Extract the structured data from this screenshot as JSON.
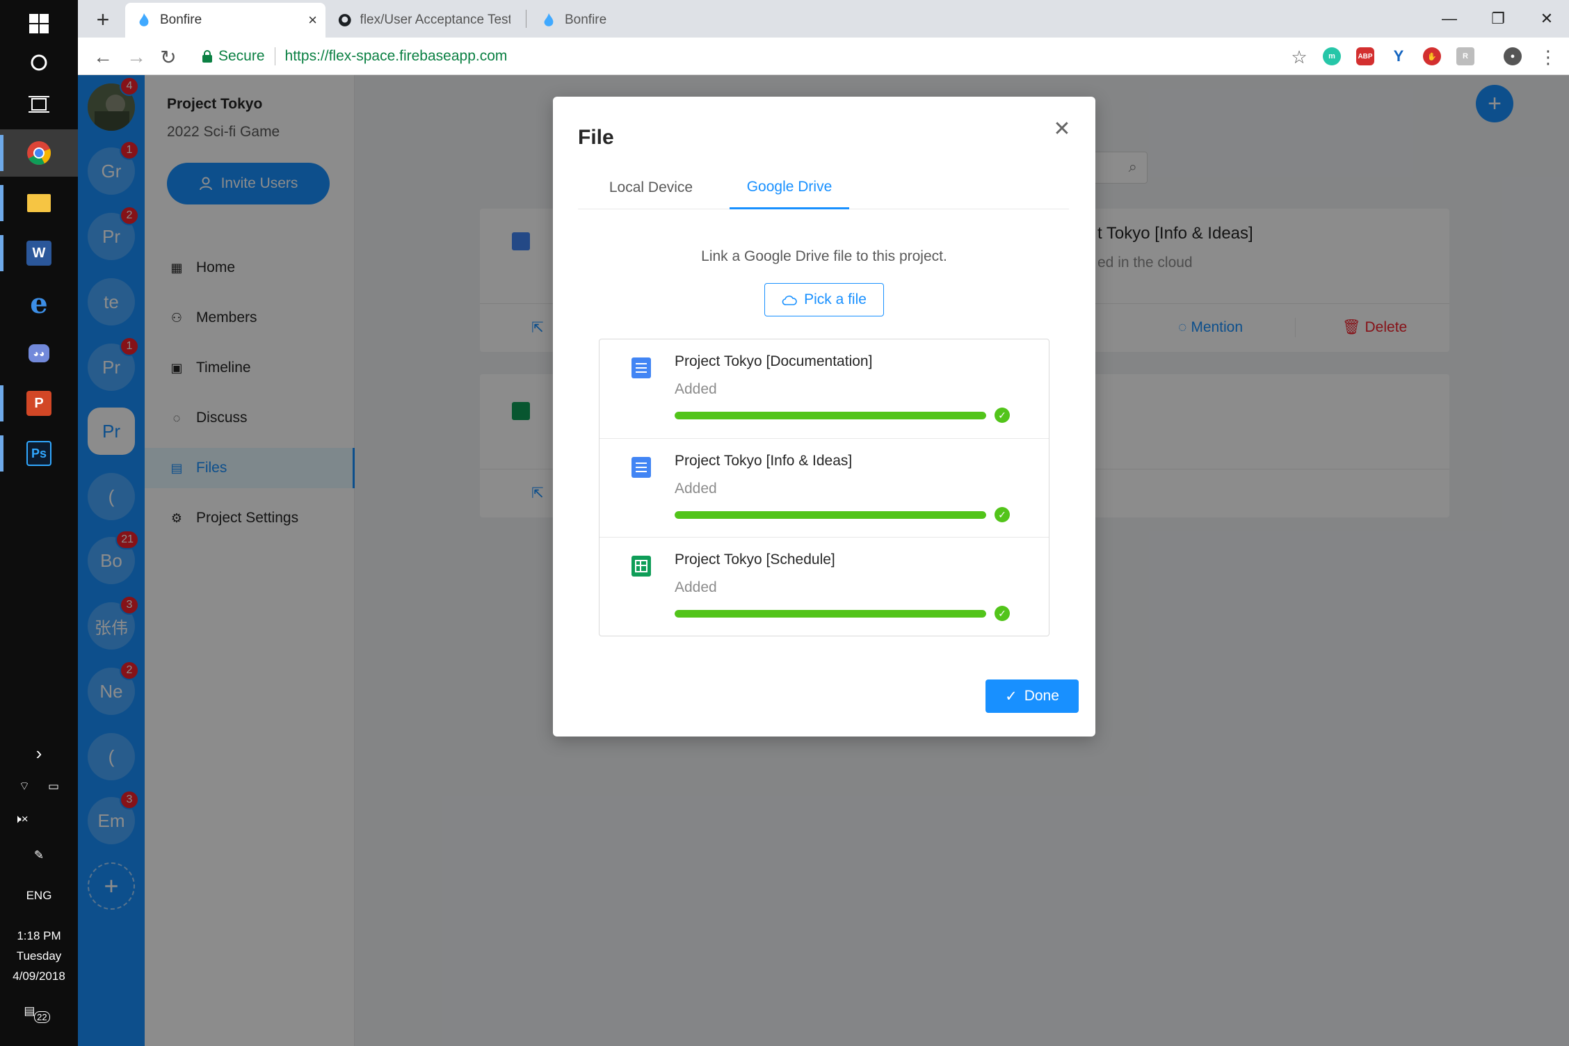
{
  "taskbar": {
    "lang": "ENG",
    "time": "1:18 PM",
    "day": "Tuesday",
    "date": "4/09/2018",
    "notifications": "22"
  },
  "browser": {
    "tabs": [
      {
        "title": "Bonfire",
        "active": true
      },
      {
        "title": "flex/User Acceptance Testing"
      },
      {
        "title": "Bonfire"
      }
    ],
    "secure_label": "Secure",
    "url": "https://flex-space.firebaseapp.com",
    "extensions": [
      {
        "icon": "m-icon",
        "label": "m",
        "color": "#26c6a8"
      },
      {
        "icon": "abp-icon",
        "label": "ABP",
        "color": "#d32f2f"
      },
      {
        "icon": "y-icon",
        "label": "Y",
        "color": "#1565c0"
      },
      {
        "icon": "stop-icon",
        "label": "",
        "color": "#d32f2f"
      },
      {
        "icon": "ext-gray-icon",
        "label": "",
        "color": "#9e9e9e"
      }
    ]
  },
  "servers": [
    {
      "label": "",
      "badge": "4",
      "avatar": true
    },
    {
      "label": "Gr",
      "badge": "1"
    },
    {
      "label": "Pr",
      "badge": "2"
    },
    {
      "label": "te",
      "badge": ""
    },
    {
      "label": "Pr",
      "badge": "1"
    },
    {
      "label": "Pr",
      "badge": "",
      "selected": true
    },
    {
      "label": "(",
      "badge": ""
    },
    {
      "label": "Bo",
      "badge": "21"
    },
    {
      "label": "张伟",
      "badge": "3"
    },
    {
      "label": "Ne",
      "badge": "2"
    },
    {
      "label": "(",
      "badge": ""
    },
    {
      "label": "Em",
      "badge": "3"
    }
  ],
  "project": {
    "name": "Project Tokyo",
    "subtitle": "2022 Sci-fi Game",
    "invite_label": "Invite Users",
    "menu": [
      {
        "label": "Home",
        "icon": "home-icon"
      },
      {
        "label": "Members",
        "icon": "members-icon"
      },
      {
        "label": "Timeline",
        "icon": "calendar-icon"
      },
      {
        "label": "Discuss",
        "icon": "chat-icon"
      },
      {
        "label": "Files",
        "icon": "file-icon",
        "active": true
      },
      {
        "label": "Project Settings",
        "icon": "settings-icon"
      }
    ]
  },
  "background_card": {
    "title_partial": "t Tokyo [Info & Ideas]",
    "sub_partial": "ed in the cloud",
    "mention": "Mention",
    "delete": "Delete"
  },
  "modal": {
    "title": "File",
    "tabs": [
      "Local Device",
      "Google Drive"
    ],
    "active_tab": "Google Drive",
    "hint": "Link a Google Drive file to this project.",
    "pick_label": "Pick a file",
    "files": [
      {
        "name": "Project Tokyo [Documentation]",
        "status": "Added",
        "type": "docs",
        "progress": 1.0
      },
      {
        "name": "Project Tokyo [Info & Ideas]",
        "status": "Added",
        "type": "docs",
        "progress": 1.0
      },
      {
        "name": "Project Tokyo [Schedule]",
        "status": "Added",
        "type": "sheets",
        "progress": 1.0
      }
    ],
    "done_label": "Done"
  }
}
